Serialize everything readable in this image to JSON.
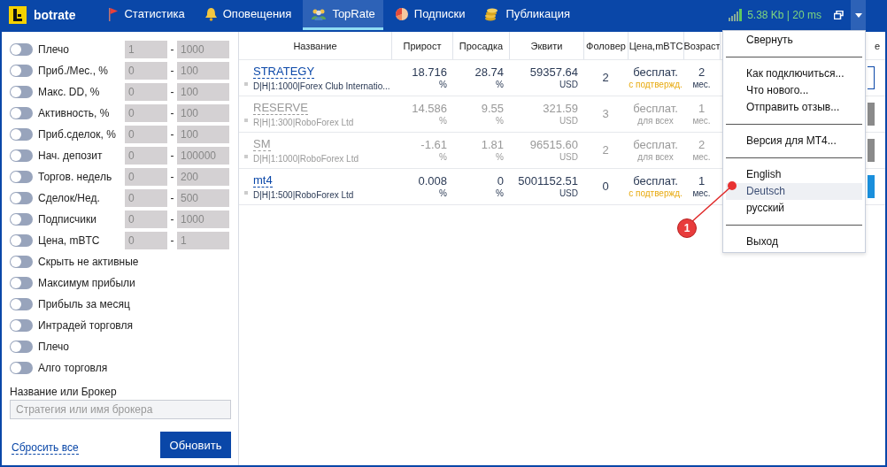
{
  "navbar": {
    "logo": "botrate",
    "tabs": [
      {
        "label": "Статистика",
        "selected": false
      },
      {
        "label": "Оповещения",
        "selected": false
      },
      {
        "label": "TopRate",
        "selected": true
      },
      {
        "label": "Подписки",
        "selected": false
      },
      {
        "label": "Публикация",
        "selected": false
      }
    ],
    "connection": "5.38 Kb | 20 ms",
    "menu_open": true
  },
  "filters": {
    "ranges": [
      {
        "label": "Плечо",
        "on": false,
        "from": "1",
        "dash": "-",
        "to": "1000"
      },
      {
        "label": "Приб./Мес., %",
        "on": false,
        "from": "0",
        "dash": "-",
        "to": "100"
      },
      {
        "label": "Макс. DD, %",
        "on": false,
        "from": "0",
        "dash": "-",
        "to": "100"
      },
      {
        "label": "Активность, %",
        "on": false,
        "from": "0",
        "dash": "-",
        "to": "100"
      },
      {
        "label": "Приб.сделок, %",
        "on": false,
        "from": "0",
        "dash": "-",
        "to": "100"
      },
      {
        "label": "Нач. депозит",
        "on": false,
        "from": "0",
        "dash": "-",
        "to": "100000"
      },
      {
        "label": "Торгов. недель",
        "on": false,
        "from": "0",
        "dash": "-",
        "to": "200"
      },
      {
        "label": "Сделок/Нед.",
        "on": false,
        "from": "0",
        "dash": "-",
        "to": "500"
      },
      {
        "label": "Подписчики",
        "on": false,
        "from": "0",
        "dash": "-",
        "to": "1000"
      },
      {
        "label": "Цена, mBTC",
        "on": false,
        "from": "0",
        "dash": "-",
        "to": "1"
      }
    ],
    "switches": [
      {
        "label": "Скрыть не активные",
        "on": false
      },
      {
        "label": "Максимум прибыли",
        "on": false
      },
      {
        "label": "Прибыль за месяц",
        "on": false
      },
      {
        "label": "Интрадей торговля",
        "on": false
      },
      {
        "label": "Плечо",
        "on": false
      },
      {
        "label": "Алго торговля",
        "on": false
      }
    ],
    "search_label": "Название или Брокер",
    "search": {
      "placeholder": "Стратегия или имя брокера"
    },
    "reset_link": "Сбросить все",
    "apply_button": "Обновить"
  },
  "table": {
    "columns": [
      "Название",
      "Прирост",
      "Просадка",
      "Эквити",
      "Фоловер",
      "Цена,mBTC",
      "Возраст",
      "е"
    ],
    "rows": [
      {
        "name": "STRATEGY",
        "meta": "D|H|1:1000|Forex Club Internatio...",
        "growth": "18.716",
        "growth_unit": "%",
        "drawdown": "28.74",
        "drawdown_unit": "%",
        "equity": "59357.64",
        "currency": "USD",
        "followers": "2",
        "price": "бесплат.",
        "price_note": "с подтвержд.",
        "note_highlight": true,
        "age": "2",
        "age_unit": "мес.",
        "active": true,
        "kind": "outline"
      },
      {
        "name": "RESERVE",
        "meta": "R|H|1:300|RoboForex Ltd",
        "growth": "14.586",
        "growth_unit": "%",
        "drawdown": "9.55",
        "drawdown_unit": "%",
        "equity": "321.59",
        "currency": "USD",
        "followers": "3",
        "price": "бесплат.",
        "price_note": "для всех",
        "note_highlight": false,
        "age": "1",
        "age_unit": "мес.",
        "active": false,
        "kind": "grey"
      },
      {
        "name": "SM",
        "meta": "D|H|1:1000|RoboForex Ltd",
        "growth": "-1.61",
        "growth_unit": "%",
        "drawdown": "1.81",
        "drawdown_unit": "%",
        "equity": "96515.60",
        "currency": "USD",
        "followers": "2",
        "price": "бесплат.",
        "price_note": "для всех",
        "note_highlight": false,
        "age": "2",
        "age_unit": "мес.",
        "active": false,
        "kind": "grey"
      },
      {
        "name": "mt4",
        "meta": "D|H|1:500|RoboForex Ltd",
        "growth": "0.008",
        "growth_unit": "%",
        "drawdown": "0",
        "drawdown_unit": "%",
        "equity": "5001152.51",
        "currency": "USD",
        "followers": "0",
        "price": "бесплат.",
        "price_note": "с подтвержд.",
        "note_highlight": true,
        "age": "1",
        "age_unit": "мес.",
        "active": true,
        "kind": "blue"
      }
    ]
  },
  "menu": [
    {
      "kind": "item",
      "label": "Свернуть",
      "selected": false
    },
    {
      "kind": "divider"
    },
    {
      "kind": "item",
      "label": "Как подключиться...",
      "selected": false
    },
    {
      "kind": "item",
      "label": "Что нового...",
      "selected": false
    },
    {
      "kind": "item",
      "label": "Отправить отзыв...",
      "selected": false
    },
    {
      "kind": "divider"
    },
    {
      "kind": "item",
      "label": "Версия для MT4...",
      "selected": false
    },
    {
      "kind": "divider"
    },
    {
      "kind": "item",
      "label": "English",
      "selected": false
    },
    {
      "kind": "item",
      "label": "Deutsch",
      "selected": true
    },
    {
      "kind": "item",
      "label": "русский",
      "selected": false
    },
    {
      "kind": "divider"
    },
    {
      "kind": "item",
      "label": "Выход",
      "selected": false
    }
  ],
  "annotation": {
    "label": "1"
  }
}
